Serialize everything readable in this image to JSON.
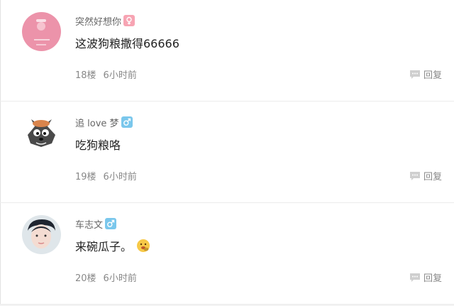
{
  "comments": [
    {
      "username": "突然好想你",
      "gender": "female",
      "content": "这波狗粮撒得66666",
      "floor": "18楼",
      "time": "6小时前",
      "reply_label": "回复",
      "avatar": "pink-avatar",
      "emoji": null
    },
    {
      "username": "追 love 梦",
      "gender": "male",
      "content": "吃狗粮咯",
      "floor": "19楼",
      "time": "6小时前",
      "reply_label": "回复",
      "avatar": "wolf-cartoon-avatar",
      "emoji": null
    },
    {
      "username": "车志文",
      "gender": "male",
      "content": "来碗瓜子。",
      "floor": "20楼",
      "time": "6小时前",
      "reply_label": "回复",
      "avatar": "boy-photo-avatar",
      "emoji": "eating-seeds-emoji"
    }
  ],
  "colors": {
    "female_badge": "#f7a4b3",
    "male_badge": "#7ac7ec",
    "meta_text": "#888888",
    "separator": "#ececec"
  }
}
